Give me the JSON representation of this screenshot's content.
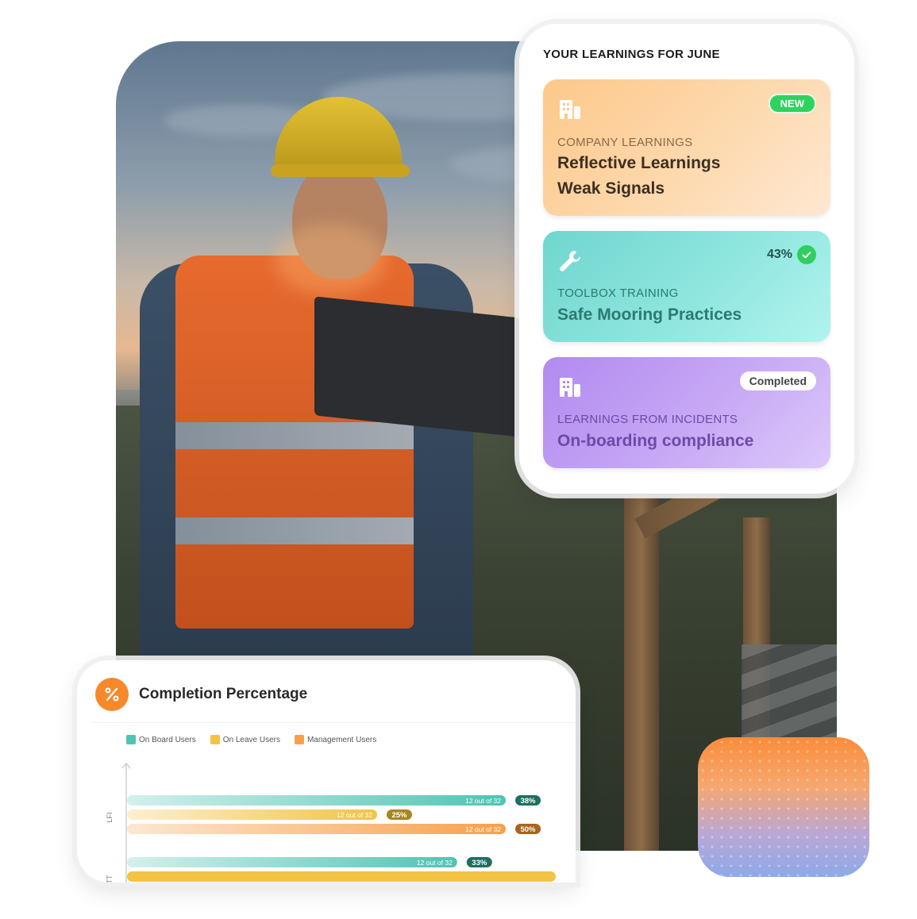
{
  "learnings": {
    "title": "YOUR LEARNINGS FOR JUNE",
    "cards": [
      {
        "icon": "building-icon",
        "badge": "NEW",
        "category": "COMPANY LEARNINGS",
        "title_line1": "Reflective Learnings",
        "title_line2": "Weak Signals"
      },
      {
        "icon": "wrench-icon",
        "progress": "43%",
        "category": "TOOLBOX TRAINING",
        "title_line1": "Safe Mooring Practices"
      },
      {
        "icon": "building-icon",
        "badge": "Completed",
        "category": "LEARNINGS FROM INCIDENTS",
        "title_line1": "On-boarding compliance"
      }
    ]
  },
  "completion": {
    "title": "Completion Percentage",
    "icon": "percent-icon"
  },
  "chart_data": {
    "type": "bar",
    "orientation": "horizontal",
    "categories": [
      "LFI",
      "TT"
    ],
    "series": [
      {
        "name": "On Board Users",
        "color": "#4fc4b3",
        "badge_color": "#1e6e62",
        "values": [
          38,
          33
        ],
        "labels": [
          "12 out of 32",
          "12 out of 32"
        ],
        "badges": [
          "38%",
          "33%"
        ]
      },
      {
        "name": "On Leave Users",
        "color": "#f3c344",
        "badge_color": "#a8861e",
        "values": [
          25,
          100
        ],
        "labels": [
          "12 out of 32",
          ""
        ],
        "badges": [
          "25%",
          ""
        ]
      },
      {
        "name": "Management Users",
        "color": "#f7a04b",
        "badge_color": "#a8641e",
        "values": [
          50,
          null
        ],
        "labels": [
          "12 out of 32",
          ""
        ],
        "badges": [
          "50%",
          ""
        ]
      }
    ],
    "xlim": [
      0,
      100
    ],
    "legend": "top-left"
  }
}
